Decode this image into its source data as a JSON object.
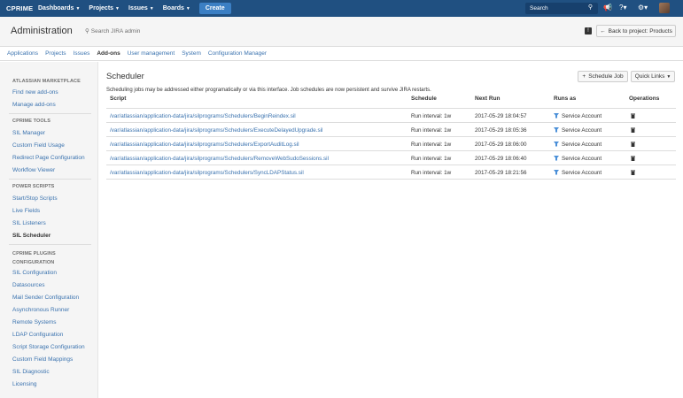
{
  "topnav": {
    "logo": "CPRIME",
    "items": [
      {
        "label": "Dashboards"
      },
      {
        "label": "Projects"
      },
      {
        "label": "Issues"
      },
      {
        "label": "Boards"
      }
    ],
    "create_label": "Create",
    "search_placeholder": "Search"
  },
  "admin": {
    "title": "Administration",
    "search_placeholder": "Search JIRA admin",
    "back_button": "Back to project: Products",
    "tabs": [
      "Applications",
      "Projects",
      "Issues",
      "Add-ons",
      "User management",
      "System",
      "Configuration Manager"
    ],
    "active_tab": "Add-ons"
  },
  "sidebar": {
    "sections": [
      {
        "heading": "ATLASSIAN MARKETPLACE",
        "items": [
          "Find new add-ons",
          "Manage add-ons"
        ]
      },
      {
        "heading": "CPRIME TOOLS",
        "items": [
          "SIL Manager",
          "Custom Field Usage",
          "Redirect Page Configuration",
          "Workflow Viewer"
        ]
      },
      {
        "heading": "POWER SCRIPTS",
        "items": [
          "Start/Stop Scripts",
          "Live Fields",
          "SIL Listeners",
          "SIL Scheduler"
        ]
      },
      {
        "heading": "CPRIME PLUGINS CONFIGURATION",
        "items": [
          "SIL Configuration",
          "Datasources",
          "Mail Sender Configuration",
          "Asynchronous Runner",
          "Remote Systems",
          "LDAP Configuration",
          "Script Storage Configuration",
          "Custom Field Mappings",
          "SIL Diagnostic",
          "Licensing"
        ]
      }
    ],
    "active_item": "SIL Scheduler"
  },
  "main": {
    "title": "Scheduler",
    "description": "Scheduling jobs may be addressed either programatically or via this interface. Job schedules are now persistent and survive JIRA restarts.",
    "schedule_button": "Schedule Job",
    "quick_links": "Quick Links",
    "columns": [
      "Script",
      "Schedule",
      "Next Run",
      "Runs as",
      "Operations"
    ],
    "rows": [
      {
        "script": "/var/atlassian/application-data/jira/silprograms/Schedulers/BeginReindex.sil",
        "schedule": "Run interval: 1w",
        "next_run": "2017-05-29 18:04:57",
        "runs_as": "Service Account"
      },
      {
        "script": "/var/atlassian/application-data/jira/silprograms/Schedulers/ExecuteDelayedUpgrade.sil",
        "schedule": "Run interval: 1w",
        "next_run": "2017-05-29 18:05:36",
        "runs_as": "Service Account"
      },
      {
        "script": "/var/atlassian/application-data/jira/silprograms/Schedulers/ExportAuditLog.sil",
        "schedule": "Run interval: 1w",
        "next_run": "2017-05-29 18:06:00",
        "runs_as": "Service Account"
      },
      {
        "script": "/var/atlassian/application-data/jira/silprograms/Schedulers/RemoveWebSudoSessions.sil",
        "schedule": "Run interval: 1w",
        "next_run": "2017-05-29 18:06:40",
        "runs_as": "Service Account"
      },
      {
        "script": "/var/atlassian/application-data/jira/silprograms/Schedulers/SyncLDAPStatus.sil",
        "schedule": "Run interval: 1w",
        "next_run": "2017-05-29 18:21:56",
        "runs_as": "Service Account"
      }
    ]
  }
}
